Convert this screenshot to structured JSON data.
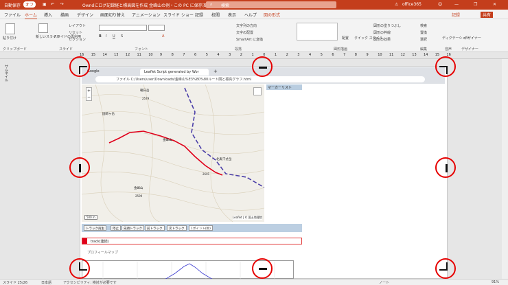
{
  "titlebar": {
    "autosave": "自動保存",
    "autosave_state": "オフ",
    "doc_title": "Owndにログ記録経と標高図を作成 金峰山の例・この PC に保存済み",
    "search_placeholder": "検索",
    "account": "office365"
  },
  "menu": {
    "tabs": [
      "ファイル",
      "ホーム",
      "挿入",
      "描画",
      "デザイン",
      "画面切り替え",
      "アニメーション",
      "スライド ショー",
      "記録",
      "校閲",
      "表示",
      "ヘルプ",
      "図の形式"
    ],
    "active": "ホーム",
    "record": "記録",
    "share": "共有"
  },
  "ribbon": {
    "paste": "貼り付け",
    "new_slide": "新しいスライド",
    "reuse_slide": "スライドの再利用",
    "layout": "レイアウト",
    "reset": "リセット",
    "section": "セクション",
    "text_direction": "文字列の方向",
    "align_text": "文字の配置",
    "smartart": "SmartArt に変換",
    "arrange": "配置",
    "quick_styles": "クイック スタイル",
    "shape_fill": "図形の塗りつぶし",
    "shape_outline": "図形の枠線",
    "shape_effects": "図形の効果",
    "find": "検索",
    "replace": "置換",
    "select": "選択",
    "dictate": "ディクテーション",
    "designer": "デザイナー",
    "groups": [
      "クリップボード",
      "スライド",
      "フォント",
      "段落",
      "図形描画",
      "編集",
      "音声",
      "デザイナー"
    ]
  },
  "ruler": {
    "ticks": [
      "16",
      "15",
      "14",
      "13",
      "12",
      "11",
      "10",
      "9",
      "8",
      "7",
      "6",
      "5",
      "4",
      "3",
      "2",
      "1",
      "0",
      "1",
      "2",
      "3",
      "4",
      "5",
      "6",
      "7",
      "8",
      "9",
      "10",
      "11",
      "12",
      "13",
      "14",
      "15",
      "16"
    ]
  },
  "thumbpane": {
    "label": "サムネイル"
  },
  "browser": {
    "tab1": "Google",
    "tab2": "Leaflet Script generated by Wor",
    "address": "ファイル C:/Users/user/Downloads/金峰山%E3%80%80ルート図と標高グラフ.html"
  },
  "map": {
    "peaks": [
      "朝日岳",
      "金峰山",
      "北奥千丈岳",
      "金峰山",
      "国師ヶ岳"
    ],
    "elevations": [
      "2579",
      "2599",
      "2601"
    ],
    "scale": "500 m",
    "attribution": "Leaflet | © 国土地理院"
  },
  "panel": {
    "title": "マーカーリスト"
  },
  "toolbar": {
    "buttons": [
      "トラック再生",
      "停止",
      "先頭トラック",
      "前トラック",
      "次トラック"
    ],
    "select": "1ポイント(秒)"
  },
  "track": {
    "label": "track(連続)"
  },
  "profile": {
    "label": "プロフィールマップ"
  },
  "status": {
    "slide": "スライド 25/26",
    "lang": "日本語",
    "accessibility": "アクセシビリティ: 検討が必要です",
    "notes": "ノート",
    "zoom": "91%"
  },
  "colors": {
    "accent": "#c43e1c",
    "track": "#e0001b",
    "handles": "#e60000",
    "trail": "#3b3bd0"
  }
}
